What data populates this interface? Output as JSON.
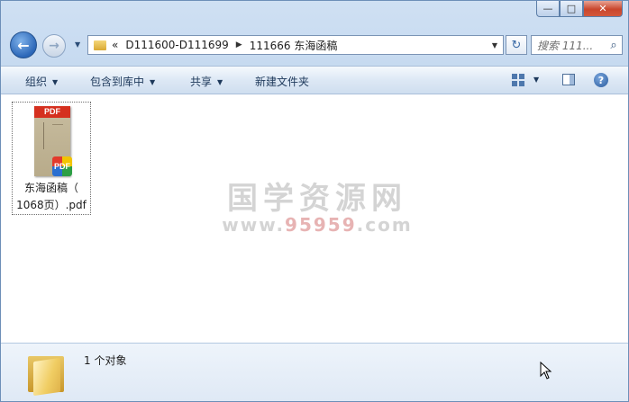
{
  "window": {
    "caption_buttons": {
      "minimize": "—",
      "maximize": "□",
      "close": "✕"
    }
  },
  "nav": {
    "back_icon": "back-arrow-icon",
    "forward_icon": "forward-arrow-icon",
    "breadcrumb": [
      "D111600-D111699",
      "111666 东海函稿"
    ],
    "breadcrumb_prefix": "«",
    "search_placeholder": "搜索 111...",
    "refresh_glyph": "↻"
  },
  "toolbar": {
    "organize": "组织",
    "include_in_library": "包含到库中",
    "share": "共享",
    "new_folder": "新建文件夹"
  },
  "files": [
    {
      "name_line1": "东海函稿（",
      "name_line2": "1068页）.pdf",
      "thumb_header": "PDF",
      "badge": "PDF"
    }
  ],
  "watermark": {
    "title": "国学资源网",
    "url_prefix": "www.",
    "url_number": "95959",
    "url_suffix": ".com"
  },
  "details": {
    "item_count": "1 个对象"
  },
  "colors": {
    "window_frame": "#b9d1ec",
    "close_button": "#c9462c",
    "pdf_red": "#d5301f"
  }
}
